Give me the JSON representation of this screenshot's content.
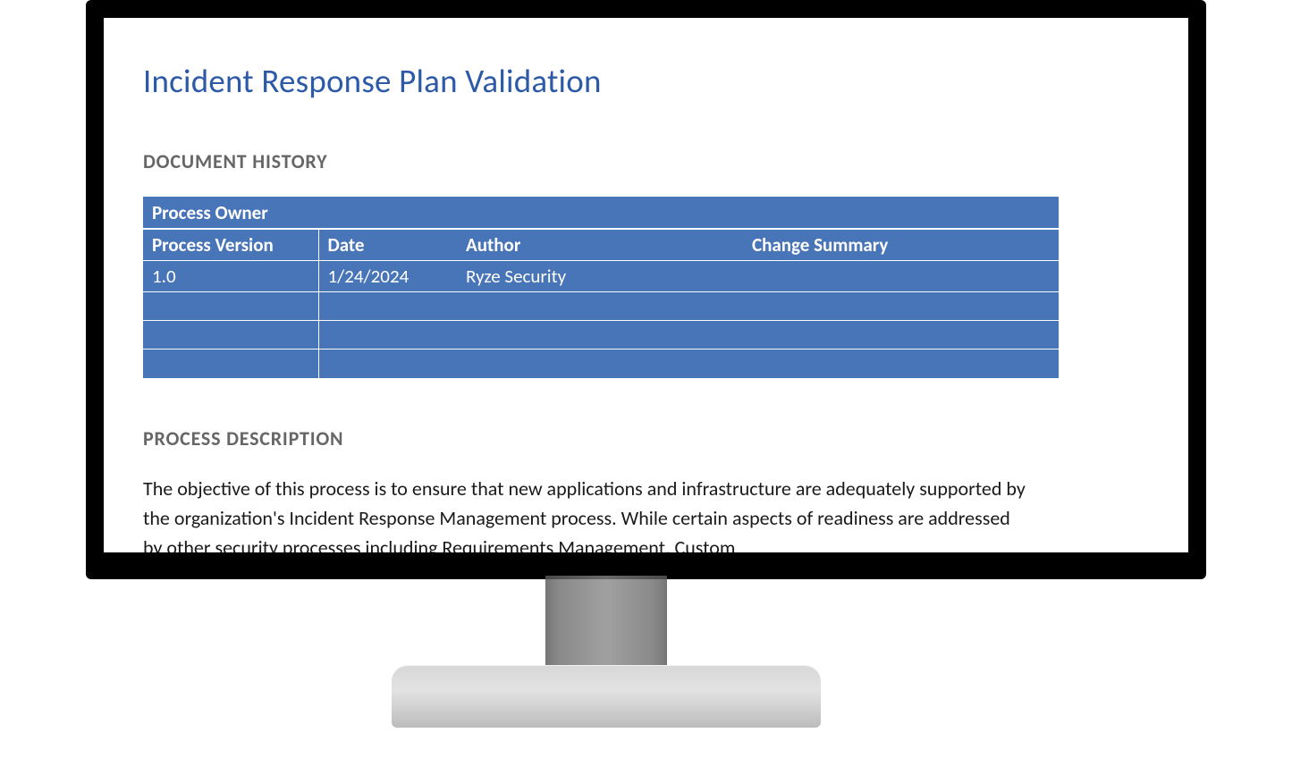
{
  "document": {
    "title": "Incident Response Plan Validation",
    "sections": {
      "history_heading": "DOCUMENT HISTORY",
      "description_heading": "PROCESS DESCRIPTION"
    },
    "history_table": {
      "owner_label": "Process Owner",
      "headers": {
        "version": "Process Version",
        "date": "Date",
        "author": "Author",
        "change_summary": "Change Summary"
      },
      "rows": [
        {
          "version": "1.0",
          "date": "1/24/2024",
          "author": "Ryze Security",
          "change_summary": ""
        }
      ]
    },
    "description_body": "The objective of this process is to ensure that new applications and infrastructure are adequately supported by the organization's Incident Response Management process.  While certain aspects of readiness are addressed by other security processes including Requirements Management, Custom"
  },
  "colors": {
    "title": "#2d5aa7",
    "table_bg": "#4874b8",
    "section_heading": "#666666"
  }
}
